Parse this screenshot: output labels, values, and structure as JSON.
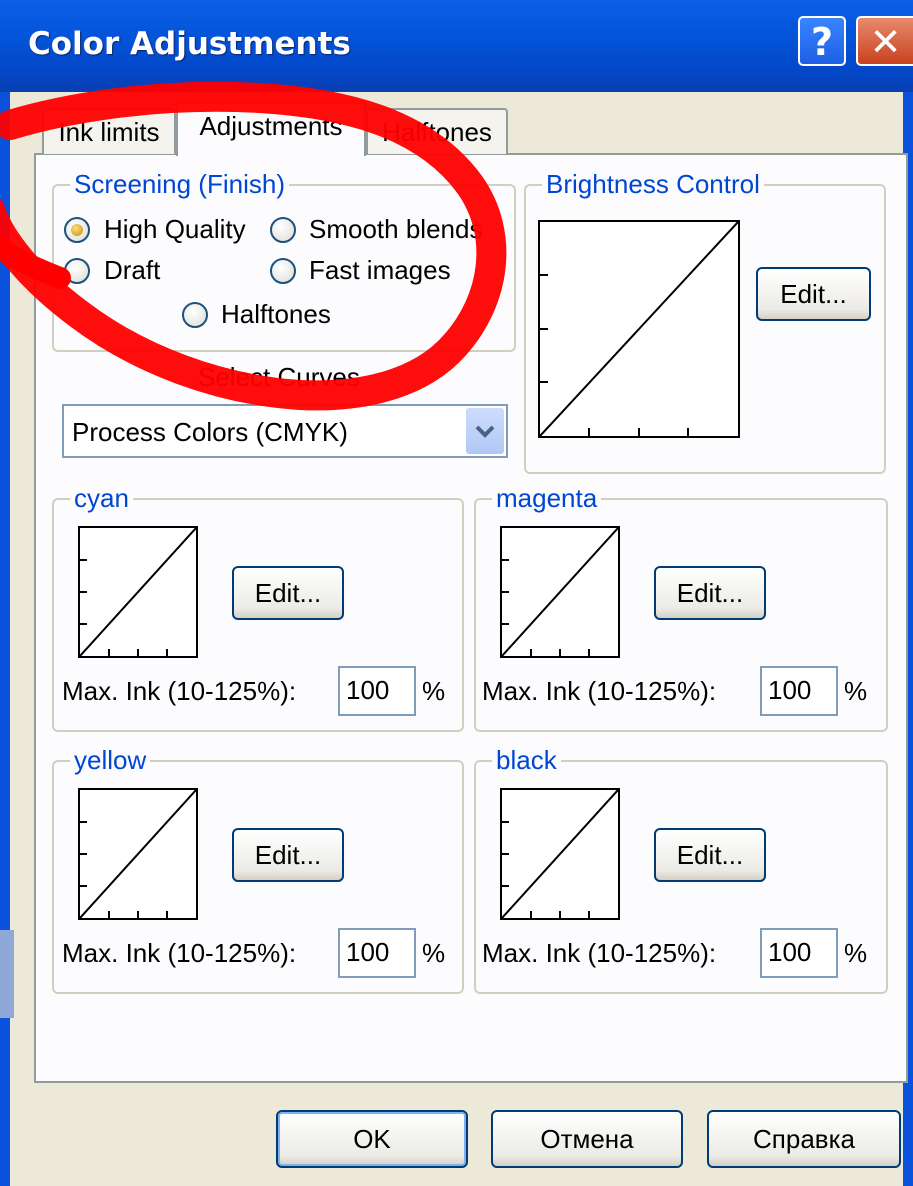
{
  "window": {
    "title": "Color Adjustments",
    "help_glyph": "?",
    "close_glyph": "✕"
  },
  "tabs": [
    {
      "label": "Ink limits",
      "active": false
    },
    {
      "label": "Adjustments",
      "active": true
    },
    {
      "label": "Halftones",
      "active": false
    }
  ],
  "screening": {
    "legend": "Screening (Finish)",
    "options": [
      {
        "label": "High Quality",
        "checked": true
      },
      {
        "label": "Smooth blends",
        "checked": false
      },
      {
        "label": "Draft",
        "checked": false
      },
      {
        "label": "Fast images",
        "checked": false
      },
      {
        "label": "Halftones",
        "checked": false
      }
    ]
  },
  "select_curves": {
    "label": "Select Curves",
    "value": "Process Colors (CMYK)",
    "arrow_icon": "chevron-down-icon"
  },
  "brightness": {
    "legend": "Brightness Control",
    "edit_label": "Edit..."
  },
  "channels": [
    {
      "name": "cyan",
      "edit_label": "Edit...",
      "max_ink_label": "Max. Ink (10-125%):",
      "value": "100",
      "unit": "%"
    },
    {
      "name": "magenta",
      "edit_label": "Edit...",
      "max_ink_label": "Max. Ink (10-125%):",
      "value": "100",
      "unit": "%"
    },
    {
      "name": "yellow",
      "edit_label": "Edit...",
      "max_ink_label": "Max. Ink (10-125%):",
      "value": "100",
      "unit": "%"
    },
    {
      "name": "black",
      "edit_label": "Edit...",
      "max_ink_label": "Max. Ink (10-125%):",
      "value": "100",
      "unit": "%"
    }
  ],
  "footer": {
    "ok_label": "OK",
    "cancel_label": "Отмена",
    "help_label": "Справка"
  },
  "colors": {
    "titlebar": "#0454d9",
    "legend_text": "#0046d5",
    "annotation": "#ff0000"
  }
}
